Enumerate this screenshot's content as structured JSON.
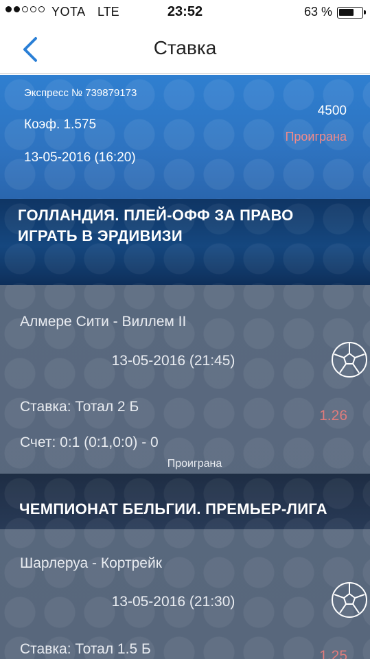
{
  "status_bar": {
    "carrier": "YOTA",
    "network": "LTE",
    "time": "23:52",
    "battery": "63 %",
    "battery_level": 0.63,
    "signal_bars": 2
  },
  "nav": {
    "title": "Ставка",
    "back_icon": "chevron-left-icon"
  },
  "bet": {
    "express": "Экспресс № 739879173",
    "coef": "Коэф. 1.575",
    "date": "13-05-2016 (16:20)",
    "amount": "4500",
    "result": "Проиграна",
    "result_color": "#f08a8a"
  },
  "leagues": [
    {
      "name": "ГОЛЛАНДИЯ. ПЛЕЙ-ОФФ ЗА ПРАВО ИГРАТЬ В ЭРДИВИЗИ",
      "event": {
        "teams": "Алмере Сити - Виллем II",
        "date": "13-05-2016 (21:45)",
        "stake": "Ставка: Тотал 2 Б",
        "odds": "1.26",
        "score": "Счет: 0:1 (0:1,0:0) - 0",
        "result": "Проиграна",
        "icon": "soccer-ball-icon"
      }
    },
    {
      "name": "ЧЕМПИОНАТ БЕЛЬГИИ. ПРЕМЬЕР-ЛИГА",
      "event": {
        "teams": "Шарлеруа - Кортрейк",
        "date": "13-05-2016 (21:30)",
        "stake": "Ставка: Тотал 1.5 Б",
        "odds": "1.25",
        "icon": "soccer-ball-icon"
      }
    }
  ]
}
